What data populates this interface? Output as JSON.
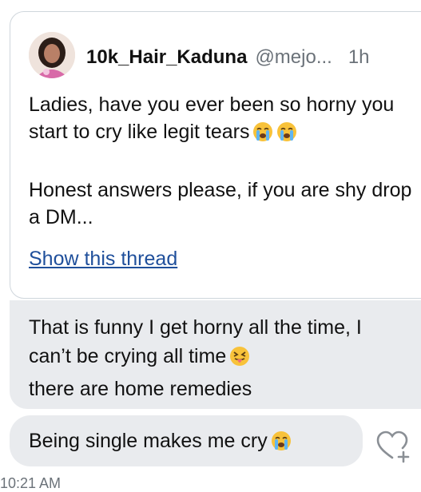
{
  "tweet": {
    "display_name": "10k_Hair_Kaduna",
    "handle": "@mejo...",
    "time": "1h",
    "text_line1": "Ladies, have you ever been so horny you start to cry like legit tears",
    "text_line2": "Honest answers please, if you are shy drop a DM...",
    "show_thread": "Show this thread"
  },
  "messages": [
    {
      "text": "That is funny I get horny all the time, I can’t be crying all time"
    },
    {
      "text": "there are home remedies"
    },
    {
      "text": "Being single makes me cry"
    }
  ],
  "timestamp": "10:21 AM",
  "icons": {
    "tweet_emoji": "loudly-crying-face",
    "reply_emoji": "squinting-face-with-tongue",
    "action": "heart-add-icon"
  },
  "colors": {
    "link": "#1f4f9b",
    "bubble": "#e9ebee",
    "border": "#cfd6dc",
    "muted": "#6b7279"
  }
}
